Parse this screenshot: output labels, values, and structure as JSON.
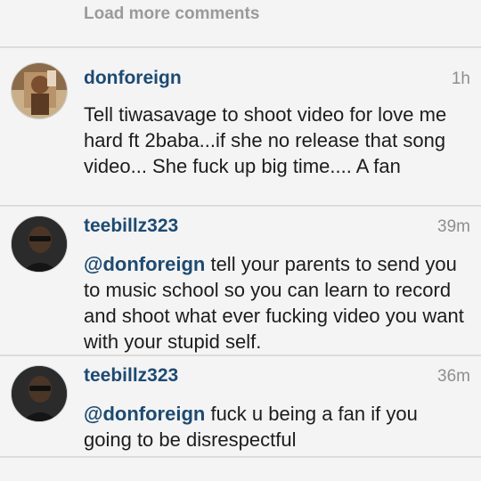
{
  "load_more": "Load more comments",
  "comments": [
    {
      "username": "donforeign",
      "time": "1h",
      "mention": "",
      "text": "Tell tiwasavage to shoot video for love me hard ft 2baba...if she no release that song video... She fuck up big time.... A fan"
    },
    {
      "username": "teebillz323",
      "time": "39m",
      "mention": "@donforeign",
      "text": "tell your parents to send you to music school so you can learn to record and shoot what ever fucking video you want with your stupid self."
    },
    {
      "username": "teebillz323",
      "time": "36m",
      "mention": "@donforeign",
      "text": "fuck u being a fan if you going to be disrespectful"
    }
  ],
  "colors": {
    "username": "#1d4a72",
    "time": "#8e8e8e",
    "text": "#1c1c1c",
    "background": "#f4f4f4"
  }
}
